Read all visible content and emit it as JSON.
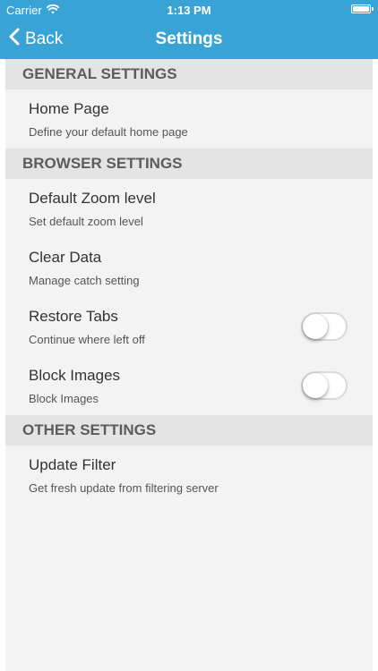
{
  "status_bar": {
    "carrier": "Carrier",
    "time": "1:13 PM",
    "wifi_icon": "wifi-icon",
    "battery_icon": "battery-icon",
    "battery_level": 1.0
  },
  "nav": {
    "back_label": "Back",
    "title": "Settings",
    "color": "#3aa3d5"
  },
  "sections": {
    "general": {
      "header": "GENERAL SETTINGS",
      "home_page": {
        "title": "Home Page",
        "subtitle": "Define your default home page"
      }
    },
    "browser": {
      "header": "BROWSER SETTINGS",
      "default_zoom": {
        "title": "Default Zoom level",
        "subtitle": "Set default zoom level"
      },
      "clear_data": {
        "title": "Clear Data",
        "subtitle": "Manage catch setting"
      },
      "restore_tabs": {
        "title": "Restore Tabs",
        "subtitle": "Continue where left off",
        "enabled": false
      },
      "block_images": {
        "title": "Block Images",
        "subtitle": "Block Images",
        "enabled": false
      }
    },
    "other": {
      "header": "OTHER SETTINGS",
      "update_filter": {
        "title": "Update Filter",
        "subtitle": "Get fresh update from filtering server"
      }
    }
  }
}
